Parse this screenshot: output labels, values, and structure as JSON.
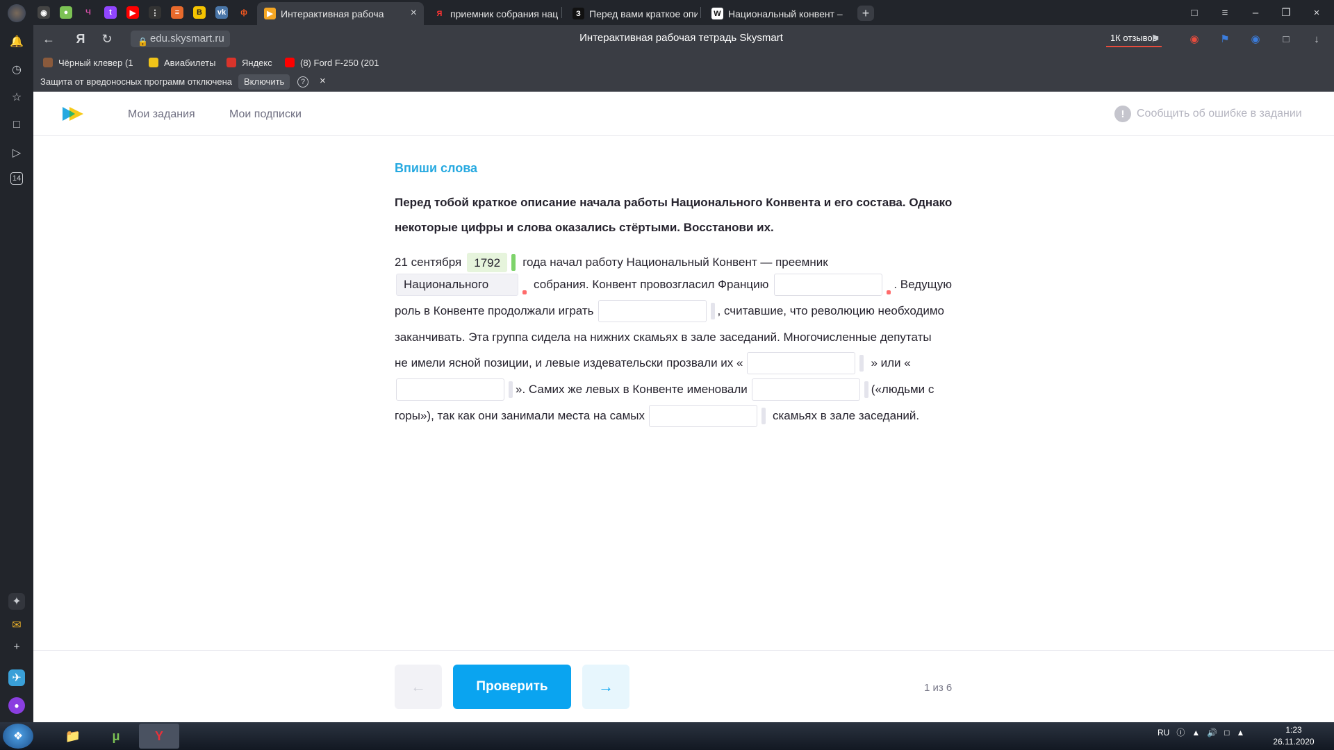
{
  "browser": {
    "tabs": [
      {
        "label": "Интерактивная рабоча",
        "active": true,
        "favicon": "skysmart-icon"
      },
      {
        "label": "приемник собрания нац",
        "active": false,
        "favicon": "yandex-icon"
      },
      {
        "label": "Перед вами краткое опис",
        "active": false,
        "favicon": "znanija-icon"
      },
      {
        "label": "Национальный конвент –",
        "active": false,
        "favicon": "wikipedia-icon"
      }
    ],
    "pinned_tabs": [
      "chrome-icon",
      "gamepad-icon",
      "letter-icon",
      "twitch-icon",
      "youtube-icon",
      "dots-icon",
      "stack-icon",
      "b-icon",
      "vk-icon",
      "ivi-icon"
    ],
    "new_tab": "+",
    "url": "edu.skysmart.ru",
    "title": "Интерактивная рабочая тетрадь Skysmart",
    "reviews": "1К отзывов",
    "bookmarks": [
      {
        "label": "Чёрный клевер (1",
        "color": "#8a5a3c"
      },
      {
        "label": "Авиабилеты",
        "color": "#f0c419"
      },
      {
        "label": "Яндекс",
        "color": "#d9342b"
      },
      {
        "label": "(8) Ford F-250 (201",
        "color": "#ff0000"
      }
    ],
    "protection": {
      "text": "Защита от вредоносных программ отключена",
      "button": "Включить",
      "help": "?",
      "close": "×"
    }
  },
  "site": {
    "nav": [
      "Мои задания",
      "Мои подписки"
    ],
    "report": "Сообщить об ошибке в задании",
    "report_icon": "!"
  },
  "task": {
    "title": "Впиши слова",
    "instruction": "Перед тобой краткое описание начала работы Национального Конвента и его состава. Однако некоторые цифры и слова оказались стёртыми. Восстанови их.",
    "text": {
      "l1_a": "21 сентября",
      "blank1": "1792",
      "l1_b": "года начал работу Национальный Конвент — преемник",
      "blank2": "Национального",
      "l2_a": "собрания. Конвент провозгласил Францию",
      "blank3": "",
      "l2_b": ". Ведущую",
      "l3_a": "роль в Конвенте продолжали играть",
      "blank4": "",
      "l3_b": ", считавшие, что революцию необходимо",
      "l4": "заканчивать. Эта группа сидела на нижних скамьях в зале заседаний. Многочисленные депутаты",
      "l5_a": "не имели ясной позиции, и левые издевательски прозвали их «",
      "blank5": "",
      "l5_b": "» или «",
      "blank6": "",
      "l6_a": "». Самих же левых в Конвенте именовали",
      "blank7": "",
      "l6_b": "(«людьми с",
      "l7_a": "горы»), так как они занимали места на самых",
      "blank8": "",
      "l7_b": "скамьях в зале заседаний."
    }
  },
  "footer": {
    "prev": "←",
    "check": "Проверить",
    "next": "→",
    "pager": "1 из 6"
  },
  "taskbar": {
    "lang": "RU",
    "time": "1:23",
    "date": "26.11.2020"
  },
  "colors": {
    "accent": "#0aa4f0",
    "title": "#26a9e0",
    "correct": "#7ed36b",
    "error": "#ff6b6b"
  }
}
